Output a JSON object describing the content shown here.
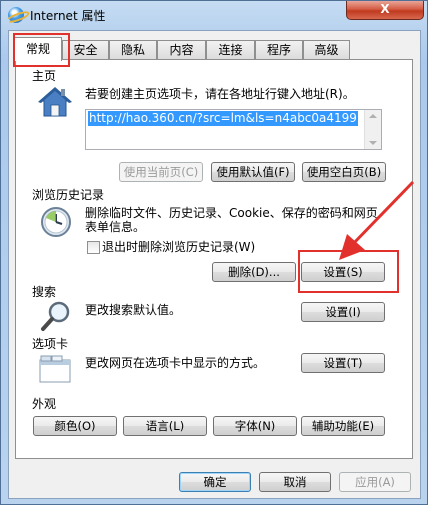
{
  "window": {
    "title": "Internet 属性",
    "close_label": "X"
  },
  "tabs": [
    {
      "label": "常规"
    },
    {
      "label": "安全"
    },
    {
      "label": "隐私"
    },
    {
      "label": "内容"
    },
    {
      "label": "连接"
    },
    {
      "label": "程序"
    },
    {
      "label": "高级"
    }
  ],
  "homepage": {
    "title": "主页",
    "description": "若要创建主页选项卡，请在各地址行键入地址(R)。",
    "url": "http://hao.360.cn/?src=lm&ls=n4abc0a4199",
    "use_current": "使用当前页(C)",
    "use_default": "使用默认值(F)",
    "use_blank": "使用空白页(B)"
  },
  "history": {
    "title": "浏览历史记录",
    "description_line1": "删除临时文件、历史记录、Cookie、保存的密码和网页",
    "description_line2": "表单信息。",
    "checkbox_label": "退出时删除浏览历史记录(W)",
    "delete_button": "删除(D)...",
    "settings_button": "设置(S)"
  },
  "search": {
    "title": "搜索",
    "description": "更改搜索默认值。",
    "settings_button": "设置(I)"
  },
  "tabs_section": {
    "title": "选项卡",
    "description": "更改网页在选项卡中显示的方式。",
    "settings_button": "设置(T)"
  },
  "appearance": {
    "title": "外观",
    "colors": "颜色(O)",
    "languages": "语言(L)",
    "fonts": "字体(N)",
    "accessibility": "辅助功能(E)"
  },
  "footer": {
    "ok": "确定",
    "cancel": "取消",
    "apply": "应用(A)"
  },
  "colors": {
    "annotation": "#e2312d",
    "selection": "#3399ff"
  }
}
